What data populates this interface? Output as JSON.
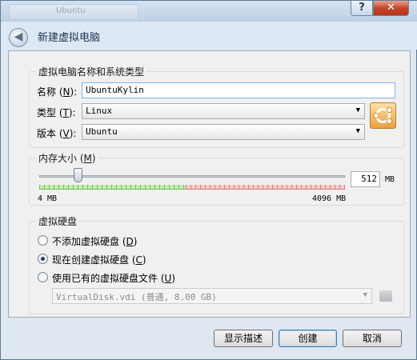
{
  "window": {
    "background_tab": "Ubuntu",
    "help_label": "?",
    "close_label": "✕",
    "title": "新建虚拟电脑"
  },
  "name_group": {
    "title": "虚拟电脑名称和系统类型",
    "name_label": "名称",
    "name_mnemonic": "N",
    "name_value": "UbuntuKylin",
    "type_label": "类型",
    "type_mnemonic": "T",
    "type_value": "Linux",
    "version_label": "版本",
    "version_mnemonic": "V",
    "version_value": "Ubuntu",
    "os_icon": "ubuntu-os-icon"
  },
  "memory_group": {
    "title": "内存大小",
    "mnemonic": "M",
    "value": "512",
    "unit": "MB",
    "min_label": "4 MB",
    "max_label": "4096 MB",
    "min_mb": 4,
    "max_mb": 4096,
    "selected_mb": 512
  },
  "disk_group": {
    "title": "虚拟硬盘",
    "options": [
      {
        "label": "不添加虚拟硬盘",
        "mnemonic": "D",
        "checked": false
      },
      {
        "label": "现在创建虚拟硬盘",
        "mnemonic": "C",
        "checked": true
      },
      {
        "label": "使用已有的虚拟硬盘文件",
        "mnemonic": "U",
        "checked": false
      }
    ],
    "file_value": "VirtualDisk.vdi (普通, 8.00 GB)"
  },
  "buttons": {
    "show_desc": "显示描述",
    "create": "创建",
    "cancel": "取消"
  },
  "colors": {
    "accent": "#3c7fb1",
    "scale_ok": "#6cc45a",
    "scale_warn": "#e07a7a"
  }
}
